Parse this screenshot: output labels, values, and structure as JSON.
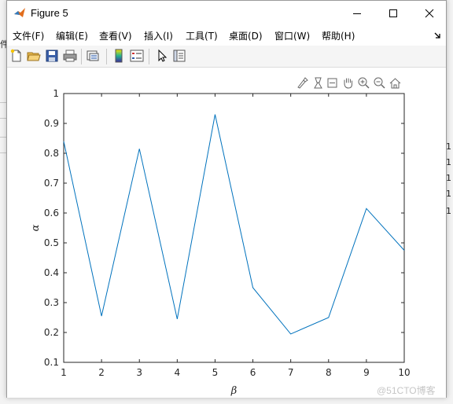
{
  "window": {
    "title": "Figure 5"
  },
  "menu": [
    {
      "label": "文件(F)",
      "name": "menu-file"
    },
    {
      "label": "编辑(E)",
      "name": "menu-edit"
    },
    {
      "label": "查看(V)",
      "name": "menu-view"
    },
    {
      "label": "插入(I)",
      "name": "menu-insert"
    },
    {
      "label": "工具(T)",
      "name": "menu-tools"
    },
    {
      "label": "桌面(D)",
      "name": "menu-desktop"
    },
    {
      "label": "窗口(W)",
      "name": "menu-window"
    },
    {
      "label": "帮助(H)",
      "name": "menu-help"
    }
  ],
  "toolbar_icons": [
    "new-figure-icon",
    "open-file-icon",
    "save-icon",
    "print-icon",
    "link-plot-icon",
    "insert-colorbar-icon",
    "insert-legend-icon",
    "edit-plot-arrow-icon",
    "property-inspector-icon"
  ],
  "axes_toolbar_icons": [
    "brush-icon",
    "data-tips-icon",
    "rotate-icon",
    "pan-hand-icon",
    "zoom-in-icon",
    "zoom-out-icon",
    "home-icon"
  ],
  "background": {
    "left_glyph": "件",
    "right_digits": [
      "1",
      "1",
      "1",
      "1",
      "1"
    ]
  },
  "watermark": "@51CTO博客",
  "colors": {
    "line": "#0072BD",
    "axes": "#262626"
  },
  "chart_data": {
    "type": "line",
    "xlabel": "β",
    "ylabel": "α",
    "xlim": [
      1,
      10
    ],
    "ylim": [
      0.1,
      1
    ],
    "xticks": [
      1,
      2,
      3,
      4,
      5,
      6,
      7,
      8,
      9,
      10
    ],
    "yticks": [
      0.1,
      0.2,
      0.3,
      0.4,
      0.5,
      0.6,
      0.7,
      0.8,
      0.9,
      1
    ],
    "grid": false,
    "box": true,
    "series": [
      {
        "x": [
          1,
          2,
          3,
          4,
          5,
          6,
          7,
          8,
          9,
          10
        ],
        "y": [
          0.84,
          0.255,
          0.815,
          0.245,
          0.93,
          0.35,
          0.195,
          0.25,
          0.615,
          0.475
        ]
      }
    ]
  }
}
